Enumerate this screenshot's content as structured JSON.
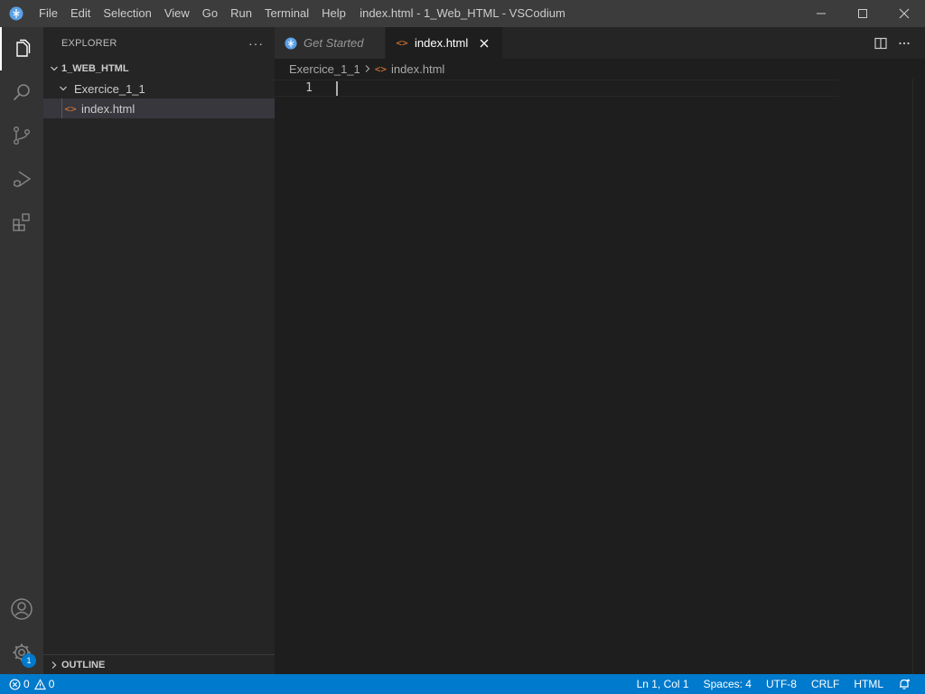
{
  "titlebar": {
    "menu": [
      "File",
      "Edit",
      "Selection",
      "View",
      "Go",
      "Run",
      "Terminal",
      "Help"
    ],
    "window_title": "index.html - 1_Web_HTML - VSCodium"
  },
  "activitybar": {
    "items": [
      "explorer-icon",
      "search-icon",
      "source-control-icon",
      "run-debug-icon",
      "extensions-icon"
    ],
    "bottom": [
      "accounts-icon",
      "manage-gear-icon"
    ],
    "manage_badge": "1"
  },
  "sidebar": {
    "title": "EXPLORER",
    "more": "···",
    "root_folder": "1_WEB_HTML",
    "folder": "Exercice_1_1",
    "file": "index.html",
    "outline": "OUTLINE"
  },
  "editor": {
    "tabs": [
      {
        "label": "Get Started",
        "active": false
      },
      {
        "label": "index.html",
        "active": true
      }
    ],
    "breadcrumb": {
      "folder": "Exercice_1_1",
      "file": "index.html"
    },
    "line_number": "1"
  },
  "statusbar": {
    "errors": "0",
    "warnings": "0",
    "position": "Ln 1, Col 1",
    "spaces": "Spaces: 4",
    "encoding": "UTF-8",
    "eol": "CRLF",
    "language": "HTML"
  },
  "colors": {
    "accent": "#007acc",
    "html_icon": "#e37933",
    "titlebar": "#3c3c3c",
    "activitybar": "#333333",
    "sidebar": "#252526",
    "editor": "#1e1e1e"
  }
}
